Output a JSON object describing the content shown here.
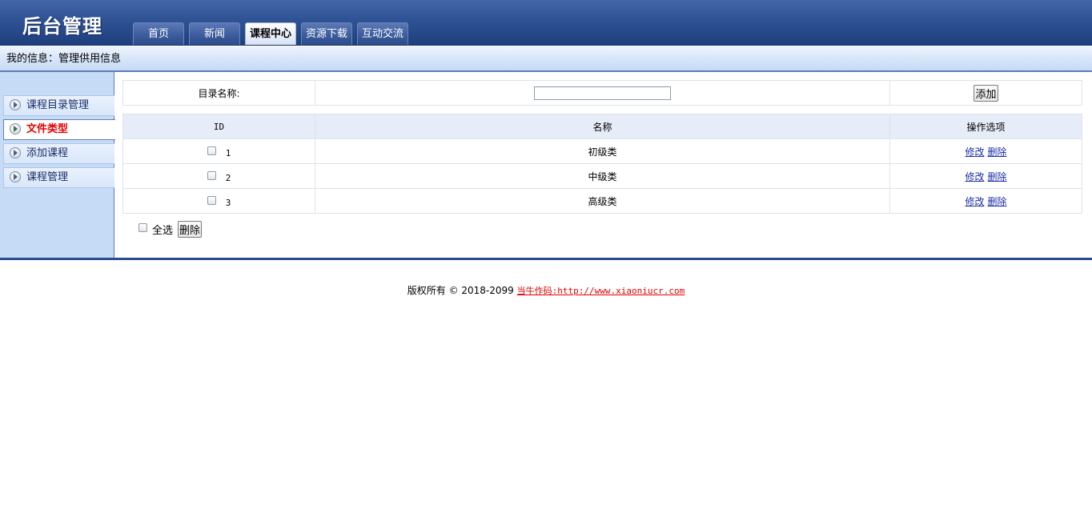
{
  "header": {
    "title": "后台管理",
    "nav": [
      {
        "label": "首页"
      },
      {
        "label": "新闻"
      },
      {
        "label": "课程中心",
        "active": true
      },
      {
        "label": "资源下载"
      },
      {
        "label": "互动交流"
      }
    ]
  },
  "infobar": {
    "text": "我的信息：管理供用信息"
  },
  "sidebar": {
    "items": [
      {
        "label": "课程目录管理"
      },
      {
        "label": "文件类型",
        "active": true
      },
      {
        "label": "添加课程"
      },
      {
        "label": "课程管理"
      }
    ]
  },
  "form": {
    "label": "目录名称:",
    "input_value": "",
    "add_button": "添加"
  },
  "table": {
    "headers": [
      "ID",
      "名称",
      "操作选项"
    ],
    "rows": [
      {
        "id": "1",
        "name": "初级类",
        "edit": "修改",
        "delete": "删除"
      },
      {
        "id": "2",
        "name": "中级类",
        "edit": "修改",
        "delete": "删除"
      },
      {
        "id": "3",
        "name": "高级类",
        "edit": "修改",
        "delete": "删除"
      }
    ]
  },
  "bulk": {
    "select_all": "全选",
    "delete_button": "删除"
  },
  "footer": {
    "copyright": "版权所有 © 2018-2099",
    "link_text": "当牛作码:http://www.xiaoniucr.com"
  },
  "colors": {
    "header_bg": "#2f5294",
    "sidebar_bg": "#c6dbf6",
    "active_link": "#e00000",
    "link": "#1d2ea6"
  }
}
